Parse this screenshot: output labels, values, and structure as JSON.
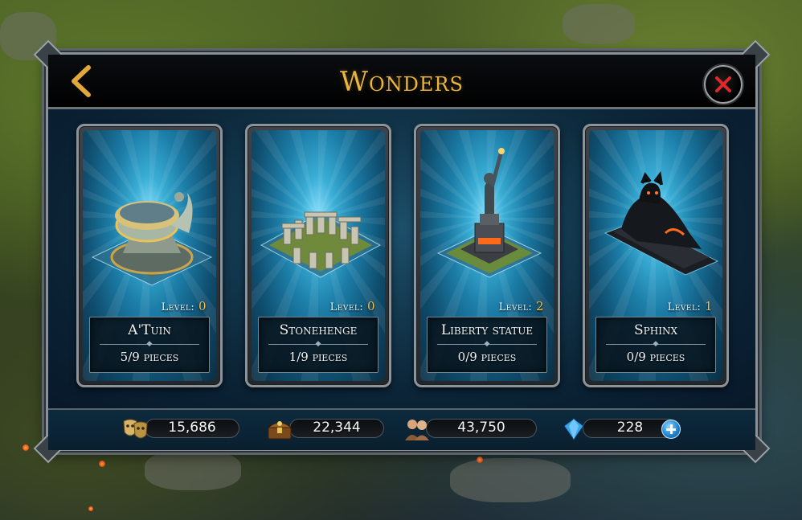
{
  "header": {
    "title": "Wonders",
    "back_icon": "chevron-left-icon",
    "close_icon": "close-icon"
  },
  "wonders": [
    {
      "name": "A'Tuin",
      "level_label": "Level:",
      "level": "0",
      "pieces": "5/9 pieces",
      "icon": "turtle-wonder-icon"
    },
    {
      "name": "Stonehenge",
      "level_label": "Level:",
      "level": "0",
      "pieces": "1/9 pieces",
      "icon": "stonehenge-icon"
    },
    {
      "name": "Liberty statue",
      "level_label": "Level:",
      "level": "2",
      "pieces": "0/9 pieces",
      "icon": "statue-icon"
    },
    {
      "name": "Sphinx",
      "level_label": "Level:",
      "level": "1",
      "pieces": "0/9 pieces",
      "icon": "sphinx-icon"
    }
  ],
  "resources": [
    {
      "icon": "masks-icon",
      "value": "15,686"
    },
    {
      "icon": "treasure-chest-icon",
      "value": "22,344"
    },
    {
      "icon": "population-icon",
      "value": "43,750"
    },
    {
      "icon": "gem-icon",
      "value": "228",
      "has_plus": true
    }
  ],
  "colors": {
    "title_gold": "#e8b540",
    "level_value": "#f0c04a",
    "panel_bg": "#0c2233",
    "card_glow": "#3aaed6"
  }
}
